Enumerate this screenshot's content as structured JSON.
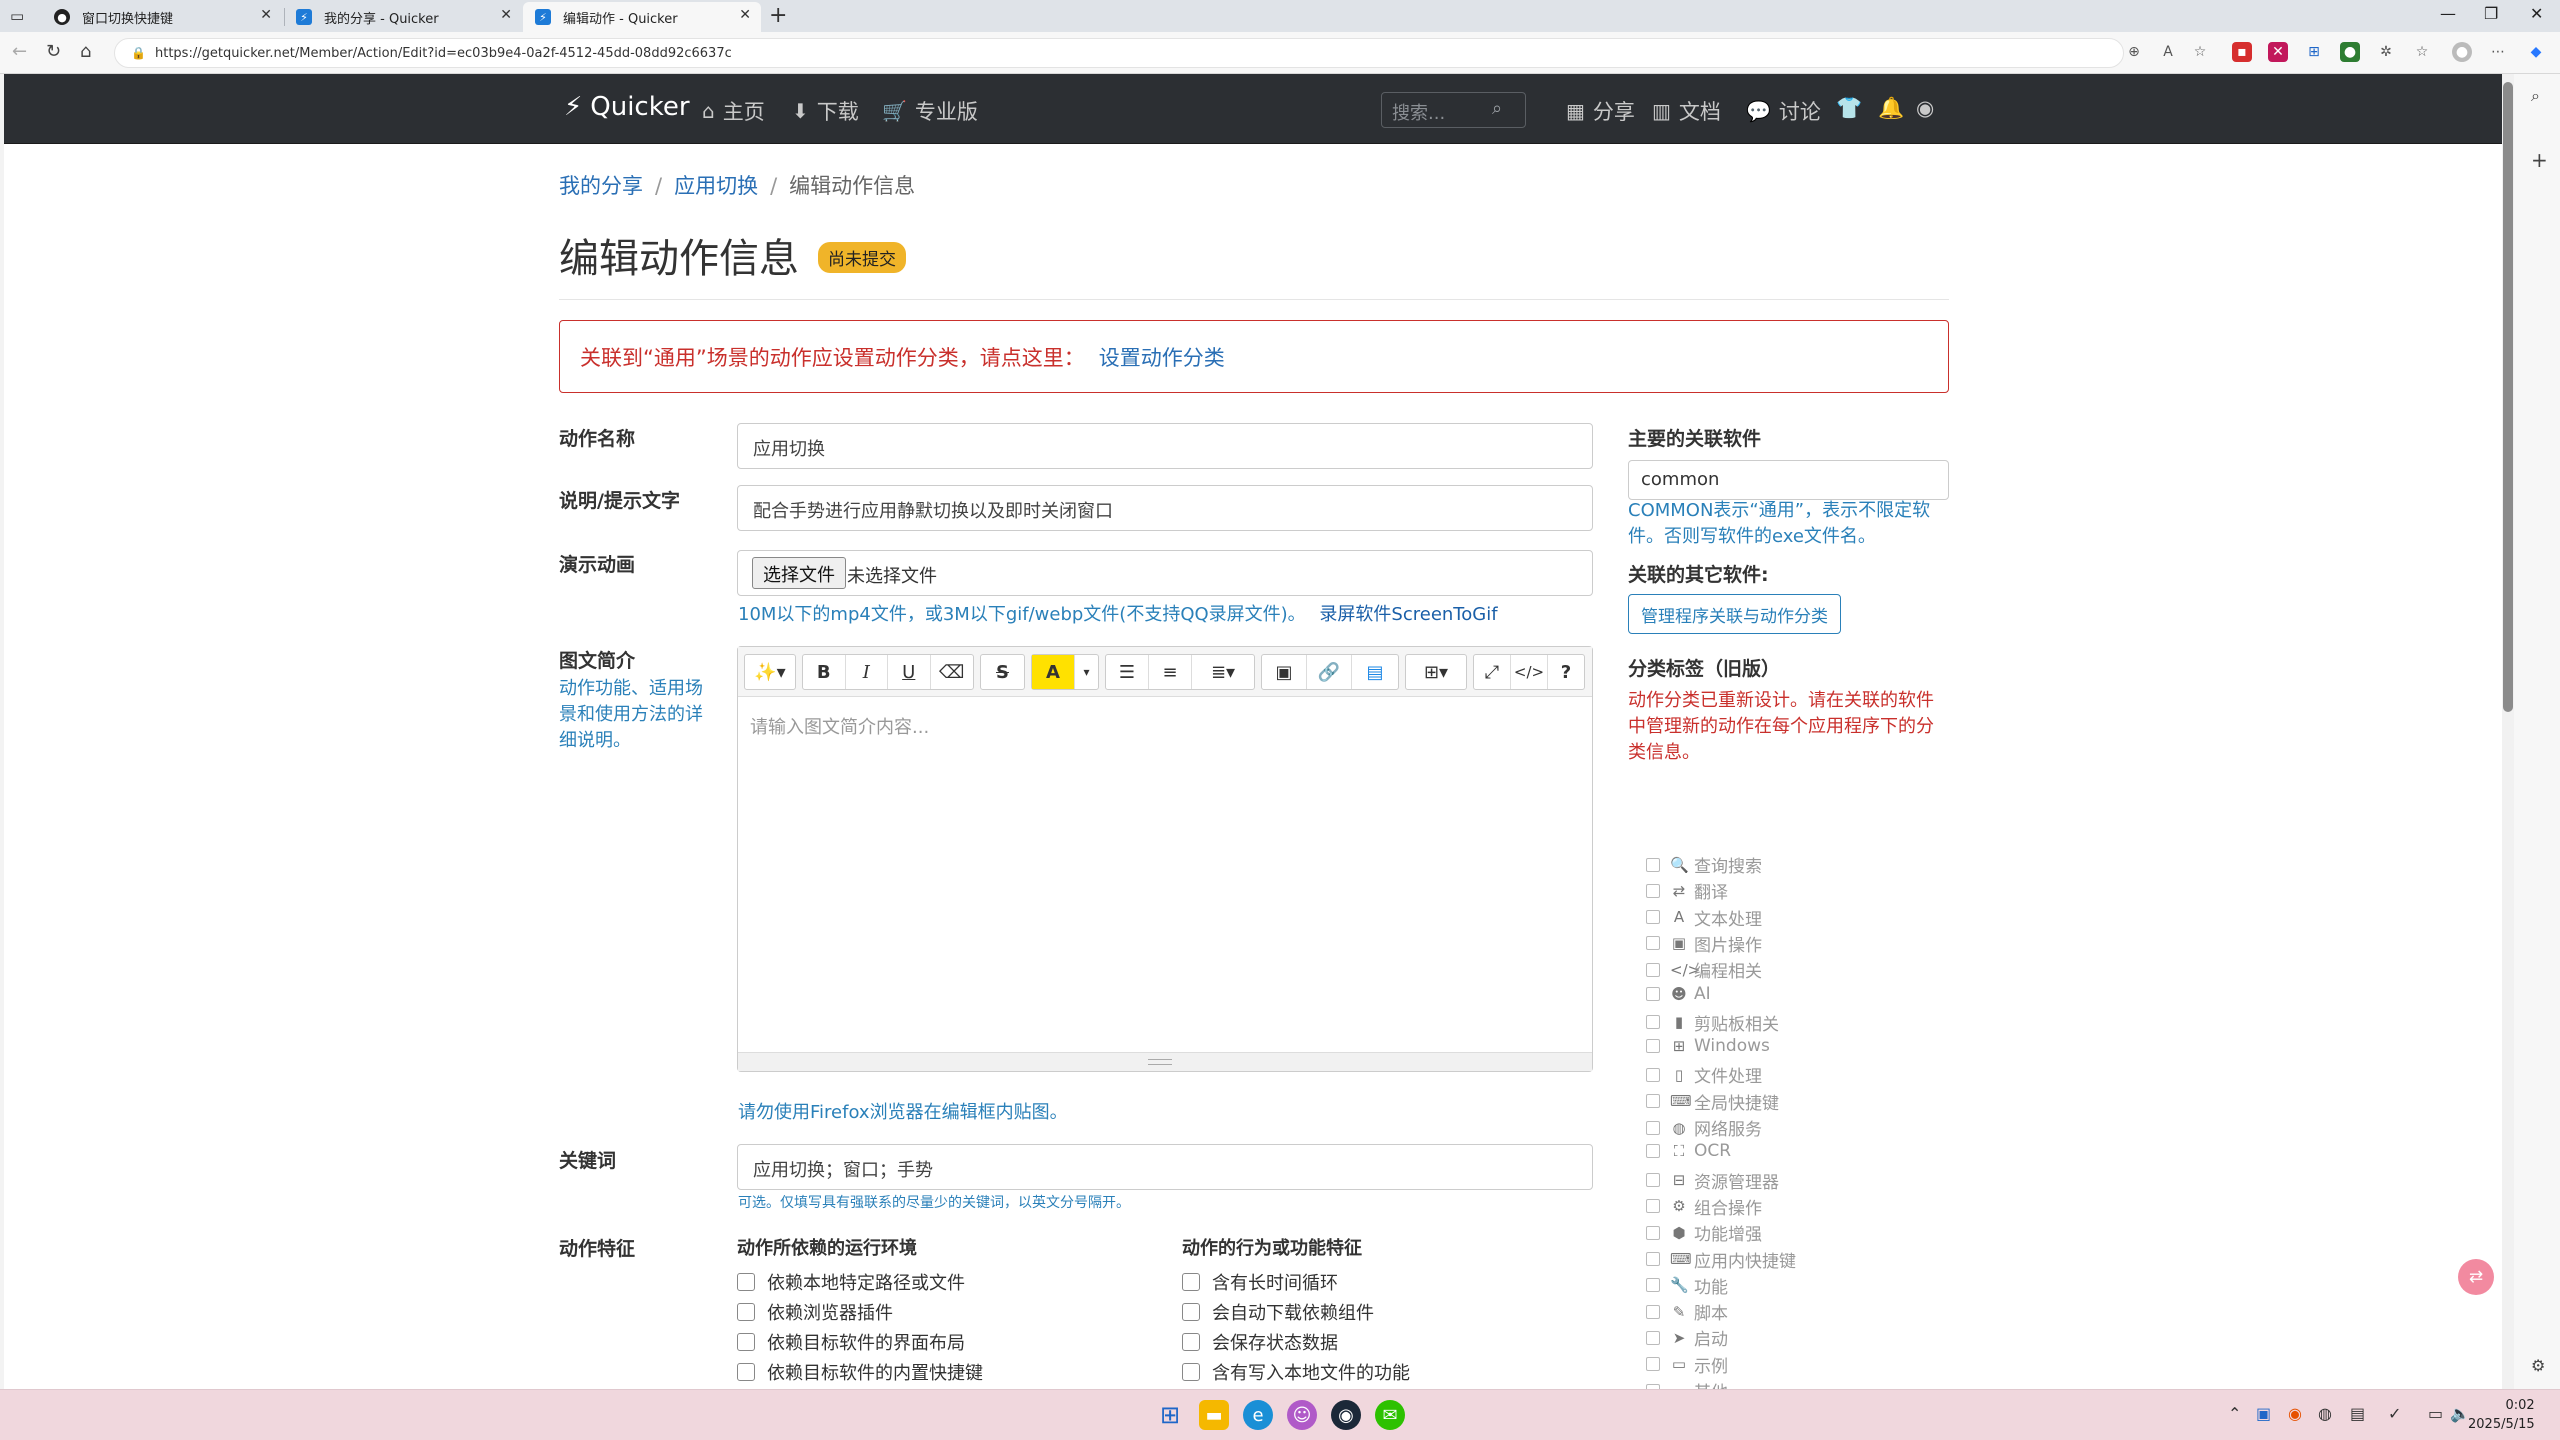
{
  "browser": {
    "tabs": [
      {
        "title": "窗口切换快捷键"
      },
      {
        "title": "我的分享 - Quicker"
      },
      {
        "title": "编辑动作 - Quicker"
      }
    ],
    "url": "https://getquicker.net/Member/Action/Edit?id=ec03b9e4-0a2f-4512-45dd-08dd92c6637c"
  },
  "nav": {
    "brand": "Quicker",
    "home": "主页",
    "download": "下载",
    "pro": "专业版",
    "search_placeholder": "搜索...",
    "share": "分享",
    "docs": "文档",
    "discuss": "讨论"
  },
  "breadcrumb": {
    "my_share": "我的分享",
    "app_switch": "应用切换",
    "current": "编辑动作信息"
  },
  "title": "编辑动作信息",
  "badge": "尚未提交",
  "alert": {
    "text": "关联到“通用”场景的动作应设置动作分类，请点这里：",
    "link": "设置动作分类"
  },
  "form": {
    "name_label": "动作名称",
    "name_value": "应用切换",
    "desc_label": "说明/提示文字",
    "desc_value": "配合手势进行应用静默切换以及即时关闭窗口",
    "anim_label": "演示动画",
    "file_button": "选择文件",
    "file_none": "未选择文件",
    "anim_help": "10M以下的mp4文件，或3M以下gif/webp文件(不支持QQ录屏文件)。",
    "anim_help_link": "录屏软件ScreenToGif",
    "intro_label": "图文简介",
    "intro_help": "动作功能、适用场景和使用方法的详细说明。",
    "intro_placeholder": "请输入图文简介内容...",
    "editor_help": "请勿使用Firefox浏览器在编辑框内贴图。",
    "keywords_label": "关键词",
    "keywords_value": "应用切换；窗口；手势",
    "keywords_help": "可选。仅填写具有强联系的尽量少的关键词，以英文分号隔开。",
    "features_label": "动作特征"
  },
  "right": {
    "main_app_label": "主要的关联软件",
    "main_app_value": "common",
    "main_app_help": "COMMON表示“通用”，表示不限定软件。否则写软件的exe文件名。",
    "other_apps_label": "关联的其它软件:",
    "manage_button": "管理程序关联与动作分类",
    "tags_label": "分类标签（旧版）",
    "tags_notice": "动作分类已重新设计。请在关联的软件中管理新的动作在每个应用程序下的分类信息。",
    "categories": [
      {
        "label": "查询搜索",
        "icon": "search-icon",
        "glyph": "🔍"
      },
      {
        "label": "翻译",
        "icon": "translate-icon",
        "glyph": "⇄"
      },
      {
        "label": "文本处理",
        "icon": "font-icon",
        "glyph": "A"
      },
      {
        "label": "图片操作",
        "icon": "images-icon",
        "glyph": "▣"
      },
      {
        "label": "编程相关",
        "icon": "code-icon",
        "glyph": "</>"
      },
      {
        "label": "AI",
        "icon": "robot-icon",
        "glyph": "☻"
      },
      {
        "label": "剪贴板相关",
        "icon": "clipboard-icon",
        "glyph": "▮"
      },
      {
        "label": "Windows",
        "icon": "windows-icon",
        "glyph": "⊞"
      },
      {
        "label": "文件处理",
        "icon": "file-icon",
        "glyph": "▯"
      },
      {
        "label": "全局快捷键",
        "icon": "keyboard-icon",
        "glyph": "⌨"
      },
      {
        "label": "网络服务",
        "icon": "globe-icon",
        "glyph": "◍"
      },
      {
        "label": "OCR",
        "icon": "expand-icon",
        "glyph": "⛶"
      },
      {
        "label": "资源管理器",
        "icon": "sitemap-icon",
        "glyph": "⊟"
      },
      {
        "label": "组合操作",
        "icon": "cogs-icon",
        "glyph": "⚙"
      },
      {
        "label": "功能增强",
        "icon": "cubes-icon",
        "glyph": "⬢"
      },
      {
        "label": "应用内快捷键",
        "icon": "keyboard-icon",
        "glyph": "⌨"
      },
      {
        "label": "功能",
        "icon": "wrench-icon",
        "glyph": "🔧"
      },
      {
        "label": "脚本",
        "icon": "scroll-icon",
        "glyph": "✎"
      },
      {
        "label": "启动",
        "icon": "paper-plane-icon",
        "glyph": "➤"
      },
      {
        "label": "示例",
        "icon": "desktop-icon",
        "glyph": "▭"
      },
      {
        "label": "其他",
        "icon": "folder-open-icon",
        "glyph": "▰"
      }
    ]
  },
  "features": {
    "env_head": "动作所依赖的运行环境",
    "env": [
      "依赖本地特定路径或文件",
      "依赖浏览器插件",
      "依赖目标软件的界面布局",
      "依赖目标软件的内置快捷键"
    ],
    "behavior_head": "动作的行为或功能特征",
    "behavior": [
      "含有长时间循环",
      "会自动下载依赖组件",
      "会保存状态数据",
      "含有写入本地文件的功能"
    ]
  },
  "taskbar": {
    "time": "0:02",
    "date": "2025/5/15"
  }
}
